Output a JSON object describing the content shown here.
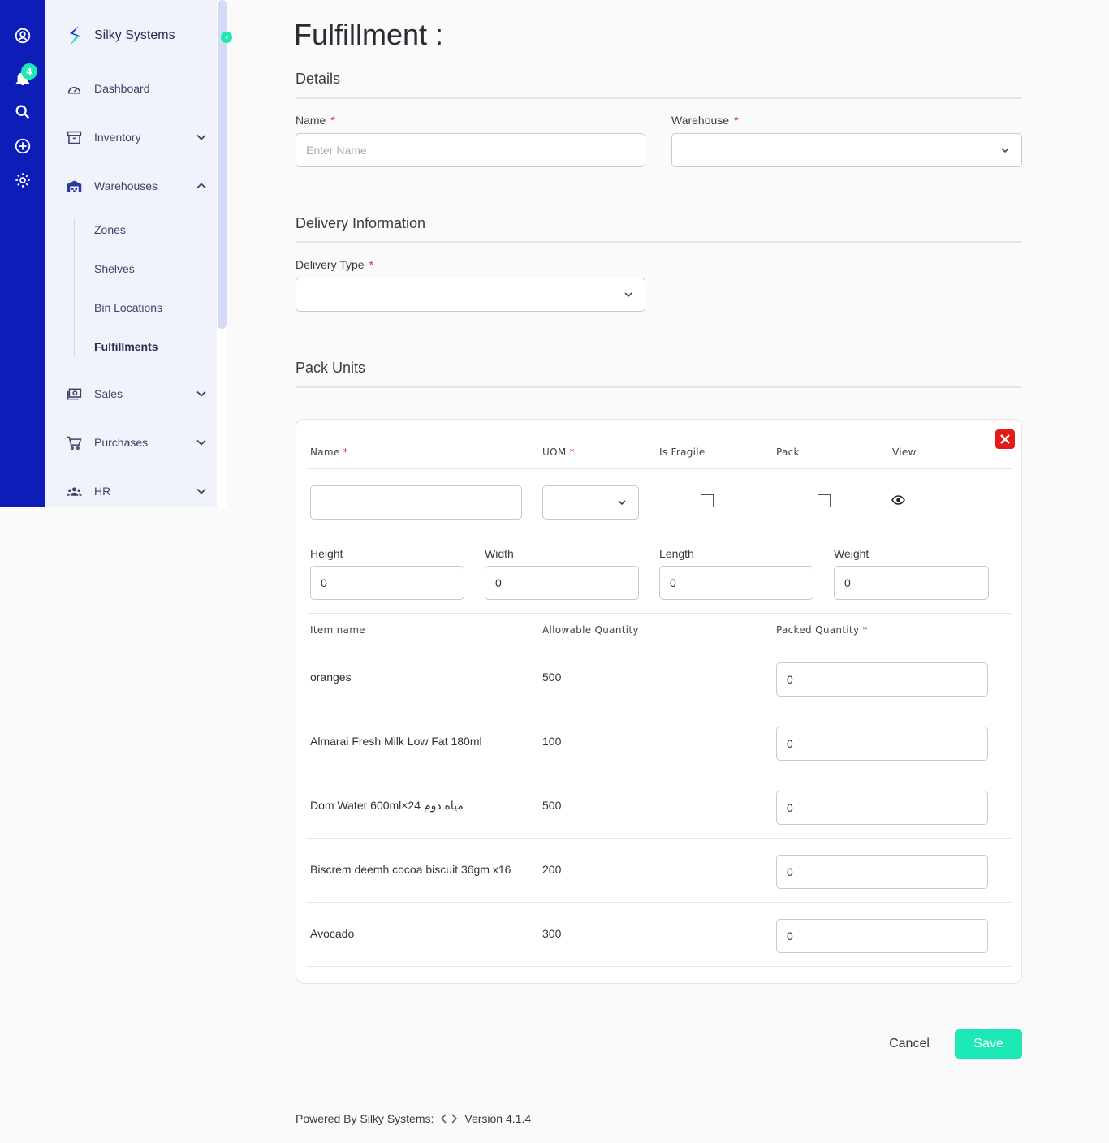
{
  "brand": {
    "name": "Silky Systems"
  },
  "rail": {
    "notification_count": "4"
  },
  "sidebar": {
    "items": [
      {
        "label": "Dashboard"
      },
      {
        "label": "Inventory"
      },
      {
        "label": "Warehouses"
      },
      {
        "label": "Sales"
      },
      {
        "label": "Purchases"
      },
      {
        "label": "HR"
      }
    ],
    "warehouses_sub": [
      {
        "label": "Zones"
      },
      {
        "label": "Shelves"
      },
      {
        "label": "Bin Locations"
      },
      {
        "label": "Fulfillments"
      }
    ]
  },
  "page": {
    "title": "Fulfillment :"
  },
  "details": {
    "title": "Details",
    "name_label": "Name",
    "name_placeholder": "Enter Name",
    "warehouse_label": "Warehouse",
    "required_mark": "*"
  },
  "delivery": {
    "title": "Delivery Information",
    "type_label": "Delivery Type"
  },
  "pack_units": {
    "title": "Pack Units",
    "headers": {
      "name": "Name",
      "uom": "UOM",
      "is_fragile": "Is Fragile",
      "pack": "Pack",
      "view": "View"
    },
    "dims": {
      "height_label": "Height",
      "height_value": "0",
      "width_label": "Width",
      "width_value": "0",
      "length_label": "Length",
      "length_value": "0",
      "weight_label": "Weight",
      "weight_value": "0"
    },
    "items_headers": {
      "item_name": "Item name",
      "allowable_qty": "Allowable Quantity",
      "packed_qty": "Packed Quantity"
    },
    "items": [
      {
        "name": "oranges",
        "allowable": "500",
        "packed": "0"
      },
      {
        "name": "Almarai Fresh Milk Low Fat 180ml",
        "allowable": "100",
        "packed": "0"
      },
      {
        "name": "Dom Water 600ml×24 مياه دوم",
        "allowable": "500",
        "packed": "0"
      },
      {
        "name": "Biscrem deemh cocoa biscuit 36gm x16",
        "allowable": "200",
        "packed": "0"
      },
      {
        "name": "Avocado",
        "allowable": "300",
        "packed": "0"
      }
    ]
  },
  "actions": {
    "cancel": "Cancel",
    "save": "Save"
  },
  "footer": {
    "powered_by": "Powered By Silky Systems:",
    "version": "Version 4.1.4"
  },
  "colors": {
    "rail": "#0d1eb8",
    "accent": "#1de9b6",
    "danger": "#e31b1b"
  }
}
